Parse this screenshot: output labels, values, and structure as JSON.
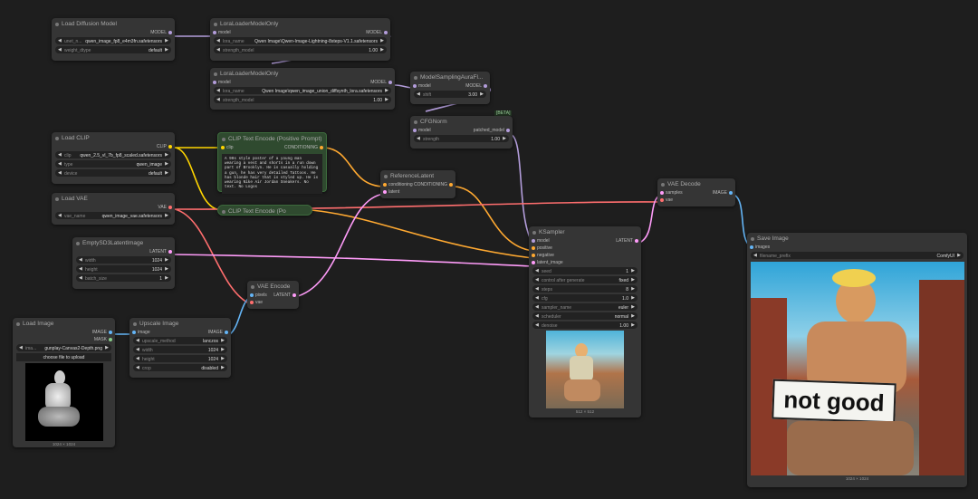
{
  "colors": {
    "model": "#b39ddb",
    "clip": "#ffd500",
    "vae": "#ff6e6e",
    "conditioning": "#ffa931",
    "latent": "#ff9cf9",
    "image": "#64b5f6"
  },
  "nodes": {
    "load_diffusion": {
      "title": "Load Diffusion Model",
      "out": "MODEL",
      "w": [
        {
          "l": "unet_n...",
          "v": "qwen_image_fp8_e4m3fn.safetensors"
        },
        {
          "l": "weight_dtype",
          "v": "default"
        }
      ]
    },
    "lora1": {
      "title": "LoraLoaderModelOnly",
      "in": "model",
      "out": "MODEL",
      "w": [
        {
          "l": "lora_name",
          "v": "Qwen Image\\Qwen-Image-Lightning-8steps-V1.1.safetensors"
        },
        {
          "l": "strength_model",
          "v": "1.00"
        }
      ]
    },
    "lora2": {
      "title": "LoraLoaderModelOnly",
      "in": "model",
      "out": "MODEL",
      "w": [
        {
          "l": "lora_name",
          "v": "Qwen Image\\qwen_image_union_diffsynth_lora.safetensors"
        },
        {
          "l": "strength_model",
          "v": "1.00"
        }
      ]
    },
    "aura": {
      "title": "ModelSamplingAuraFl...",
      "in": "model",
      "out": "MODEL",
      "w": [
        {
          "l": "shift",
          "v": "3.00"
        }
      ]
    },
    "cfgnorm": {
      "title": "CFGNorm",
      "badge": "[BETA]",
      "in": "model",
      "out": "patched_model",
      "w": [
        {
          "l": "strength",
          "v": "1.00"
        }
      ]
    },
    "load_clip": {
      "title": "Load CLIP",
      "out": "CLIP",
      "w": [
        {
          "l": "clip",
          "v": "qwen_2.5_vl_7b_fp8_scaled.safetensors"
        },
        {
          "l": "type",
          "v": "qwen_image"
        },
        {
          "l": "device",
          "v": "default"
        }
      ]
    },
    "clip_pos": {
      "title": "CLIP Text Encode (Positive Prompt)",
      "in": "clip",
      "out": "CONDITIONING",
      "text": "A 90s style poster of a young man wearing a vest and shorts in a run down part of Brooklyn. He is casually holding a gun, he has very detailed Tattoos. He has blonde hair that is styled up. He is wearing Nike Air Jordan Sneakers. No text. No Logos"
    },
    "clip_neg": {
      "title": "CLIP Text Encode (Po"
    },
    "load_vae": {
      "title": "Load VAE",
      "out": "VAE",
      "w": [
        {
          "l": "vae_name",
          "v": "qwen_image_vae.safetensors"
        }
      ]
    },
    "ref_latent": {
      "title": "ReferenceLatent",
      "in1": "conditioning",
      "in2": "latent",
      "out": "CONDITIONING"
    },
    "empty_latent": {
      "title": "EmptySD3LatentImage",
      "out": "LATENT",
      "w": [
        {
          "l": "width",
          "v": "1024"
        },
        {
          "l": "height",
          "v": "1024"
        },
        {
          "l": "batch_size",
          "v": "1"
        }
      ]
    },
    "vae_encode": {
      "title": "VAE Encode",
      "in1": "pixels",
      "in2": "vae",
      "out": "LATENT"
    },
    "load_image": {
      "title": "Load Image",
      "out1": "IMAGE",
      "out2": "MASK",
      "w": [
        {
          "l": "ima...",
          "v": "gunplay-Canvas2-Depth.png"
        }
      ],
      "button": "choose file to upload",
      "size": "1024 × 1024"
    },
    "upscale": {
      "title": "Upscale Image",
      "in": "image",
      "out": "IMAGE",
      "w": [
        {
          "l": "upscale_method",
          "v": "lanczos"
        },
        {
          "l": "width",
          "v": "1024"
        },
        {
          "l": "height",
          "v": "1024"
        },
        {
          "l": "crop",
          "v": "disabled"
        }
      ]
    },
    "ksampler": {
      "title": "KSampler",
      "ins": [
        "model",
        "positive",
        "negative",
        "latent_image"
      ],
      "out": "LATENT",
      "w": [
        {
          "l": "seed",
          "v": "1"
        },
        {
          "l": "control after generate",
          "v": "fixed"
        },
        {
          "l": "steps",
          "v": "8"
        },
        {
          "l": "cfg",
          "v": "1.0"
        },
        {
          "l": "sampler_name",
          "v": "euler"
        },
        {
          "l": "scheduler",
          "v": "normal"
        },
        {
          "l": "denoise",
          "v": "1.00"
        }
      ],
      "size": "512 × 512"
    },
    "vae_decode": {
      "title": "VAE Decode",
      "in1": "samples",
      "in2": "vae",
      "out": "IMAGE"
    },
    "save": {
      "title": "Save Image",
      "in": "images",
      "w": [
        {
          "l": "filename_prefix",
          "v": "ComfyUI"
        }
      ],
      "sign": "not good",
      "size": "1024 × 1024"
    }
  }
}
